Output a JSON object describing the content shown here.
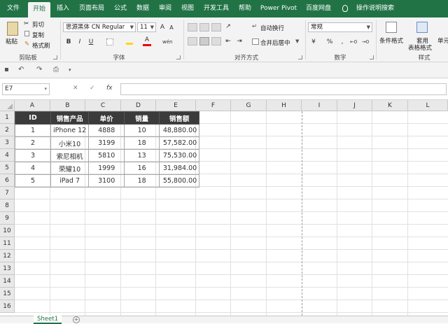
{
  "ribbon_tabs": [
    "文件",
    "开始",
    "插入",
    "页面布局",
    "公式",
    "数据",
    "审阅",
    "视图",
    "开发工具",
    "帮助",
    "Power Pivot",
    "百度网盘"
  ],
  "active_tab": "开始",
  "tell_me": "操作说明搜索",
  "clipboard": {
    "paste": "粘贴",
    "cut": "剪切",
    "copy": "复制",
    "format_painter": "格式刷",
    "label": "剪贴板"
  },
  "font": {
    "name": "思源黑体 CN Regular",
    "size": "11",
    "grow": "A",
    "shrink": "A",
    "bold": "B",
    "italic": "I",
    "underline": "U",
    "font_color": "A",
    "wen": "wén",
    "label": "字体"
  },
  "alignment": {
    "wrap_text": "自动换行",
    "merge_center": "合并后居中",
    "label": "对齐方式"
  },
  "number": {
    "format": "常规",
    "currency": "¥",
    "percent": "%",
    "comma": ",",
    "label": "数字"
  },
  "styles": {
    "conditional": "条件格式",
    "table_format_1": "套用",
    "table_format_2": "表格格式",
    "cell_styles": "单元",
    "label": "样式"
  },
  "name_box": "E7",
  "fx_cancel": "✕",
  "fx_enter": "✓",
  "fx_label": "fx",
  "columns": [
    "A",
    "B",
    "C",
    "D",
    "E",
    "F",
    "G",
    "H",
    "I",
    "J",
    "K",
    "L"
  ],
  "rows": [
    "1",
    "2",
    "3",
    "4",
    "5",
    "6",
    "7",
    "8",
    "9",
    "10",
    "11",
    "12",
    "13",
    "14",
    "15",
    "16"
  ],
  "table": {
    "headers": [
      "ID",
      "销售产品",
      "单价",
      "销量",
      "销售额"
    ],
    "rows": [
      [
        "1",
        "iPhone 12",
        "4888",
        "10",
        "48,880.00"
      ],
      [
        "2",
        "小米10",
        "3199",
        "18",
        "57,582.00"
      ],
      [
        "3",
        "索尼相机",
        "5810",
        "13",
        "75,530.00"
      ],
      [
        "4",
        "荣耀10",
        "1999",
        "16",
        "31,984.00"
      ],
      [
        "5",
        "iPad 7",
        "3100",
        "18",
        "55,800.00"
      ]
    ]
  },
  "sheet_tab": "Sheet1",
  "add_sheet": "+",
  "colors": {
    "excel_green": "#217346",
    "header_fill": "#3b3b3b"
  }
}
